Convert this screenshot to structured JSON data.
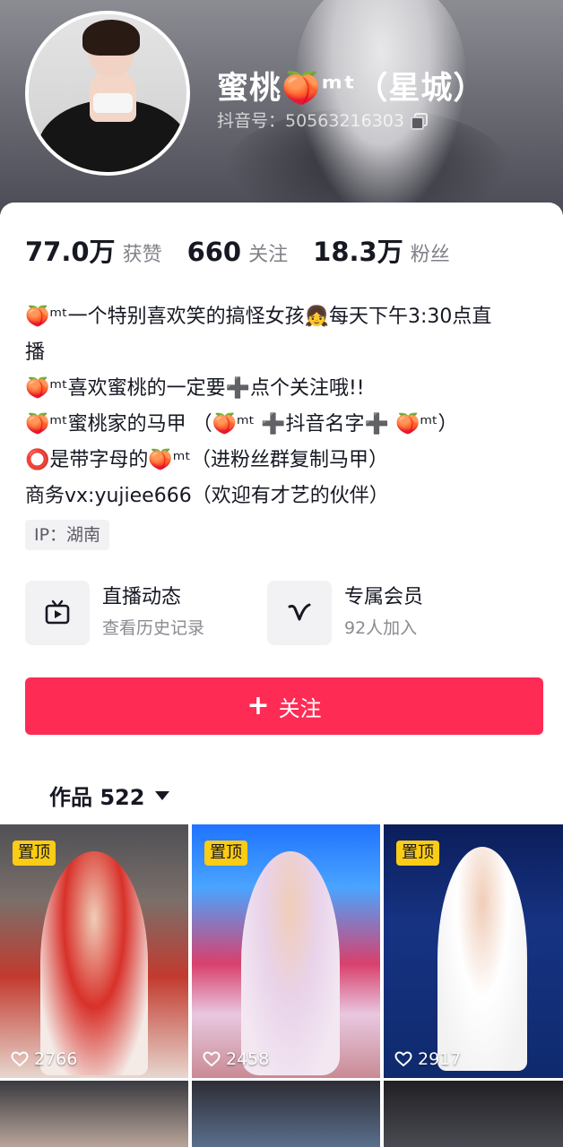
{
  "profile": {
    "name": "蜜桃🍑ᵐᵗ（星城）",
    "douyin_id": "抖音号：50563216303"
  },
  "stats": [
    {
      "value": "77.0万",
      "label": "获赞"
    },
    {
      "value": "660",
      "label": "关注"
    },
    {
      "value": "18.3万",
      "label": "粉丝"
    }
  ],
  "bio": [
    "🍑ᵐᵗ一个特别喜欢笑的搞怪女孩👧每天下午3:30点直",
    "播",
    "🍑ᵐᵗ喜欢蜜桃的一定要➕点个关注哦!!",
    "🍑ᵐᵗ蜜桃家的马甲 （🍑ᵐᵗ ➕抖音名字➕ 🍑ᵐᵗ）",
    "⭕是带字母的🍑ᵐᵗ（进粉丝群复制马甲）",
    "商务vx:yujiee666（欢迎有才艺的伙伴）"
  ],
  "ip": "IP：湖南",
  "services": [
    {
      "title": "直播动态",
      "subtitle": "查看历史记录",
      "icon": "tv-icon"
    },
    {
      "title": "专属会员",
      "subtitle": "92人加入",
      "icon": "v-icon"
    }
  ],
  "follow_button": {
    "label": "关注"
  },
  "works": {
    "label": "作品 522"
  },
  "videos": [
    {
      "pinned": "置顶",
      "likes": "2766"
    },
    {
      "pinned": "置顶",
      "likes": "2458"
    },
    {
      "pinned": "置顶",
      "likes": "2917"
    }
  ],
  "colors": {
    "accent": "#fe2c55",
    "pin": "#facc15"
  }
}
